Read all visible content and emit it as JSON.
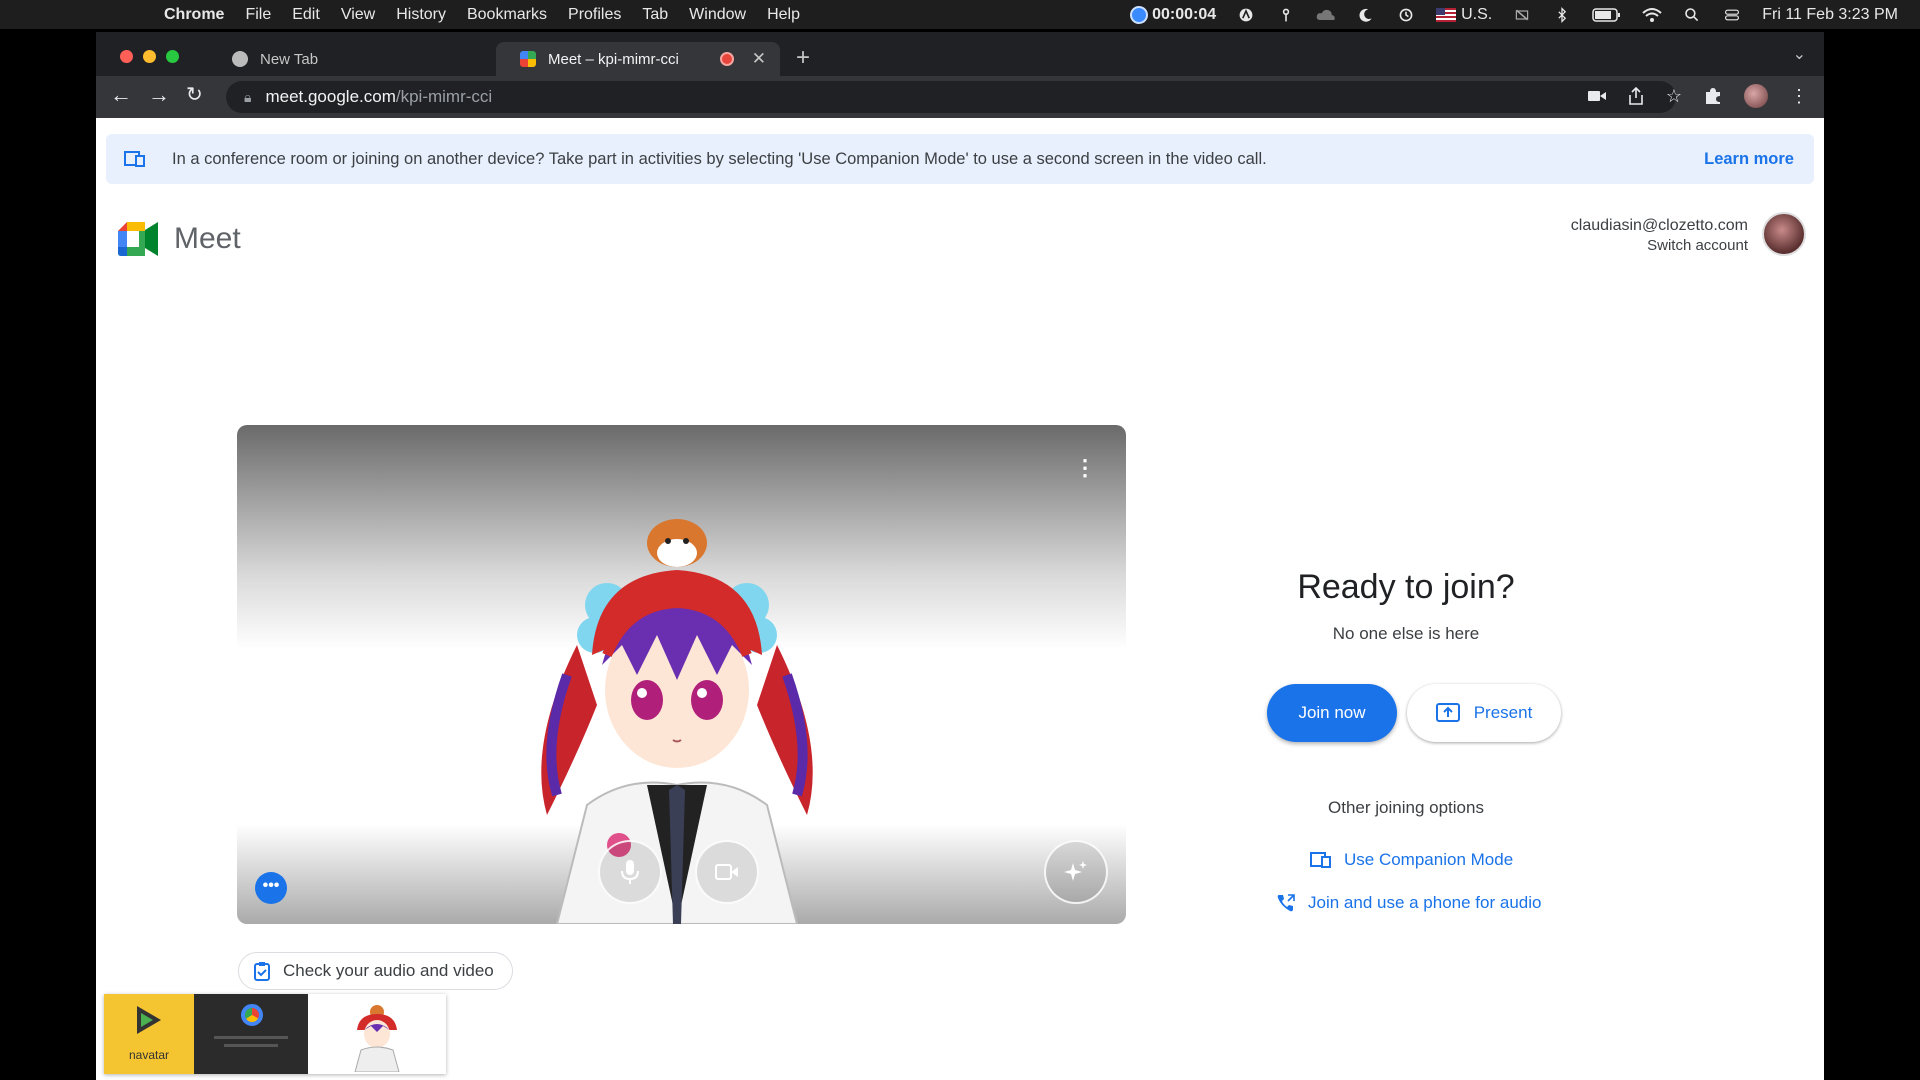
{
  "menubar": {
    "items": [
      "Chrome",
      "File",
      "Edit",
      "View",
      "History",
      "Bookmarks",
      "Profiles",
      "Tab",
      "Window",
      "Help"
    ],
    "recording_time": "00:00:04",
    "keyboard": "U.S.",
    "datetime": "Fri 11 Feb  3:23 PM"
  },
  "tabs": [
    {
      "title": "New Tab"
    },
    {
      "title": "Meet – kpi-mimr-cci"
    }
  ],
  "omnibox": {
    "host": "meet.google.com",
    "path": "/kpi-mimr-cci"
  },
  "banner": {
    "text": "In a conference room or joining on another device? Take part in activities by selecting 'Use Companion Mode' to use a second screen in the video call.",
    "learn_more": "Learn more"
  },
  "logo": {
    "name": "Meet"
  },
  "account": {
    "email": "claudiasin@clozetto.com",
    "switch": "Switch account"
  },
  "preview": {
    "more_icon": "three-dots-icon"
  },
  "check": {
    "label": "Check your audio and video"
  },
  "join": {
    "title": "Ready to join?",
    "status": "No one else is here",
    "join_label": "Join now",
    "present_label": "Present",
    "other_title": "Other joining options",
    "companion_label": "Use Companion Mode",
    "phone_label": "Join and use a phone for audio"
  },
  "thumbs": {
    "first_label": "navatar"
  },
  "colors": {
    "accent": "#1a73e8",
    "banner_bg": "#e8f0fe"
  }
}
